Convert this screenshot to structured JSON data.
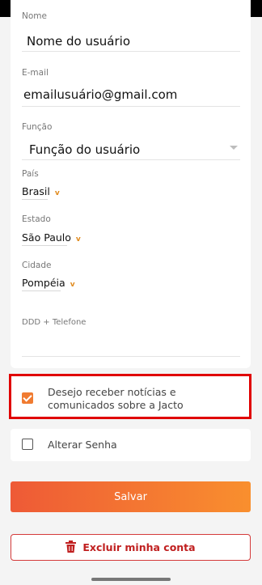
{
  "form": {
    "name_label": "Nome",
    "name_value": "Nome do usuário",
    "email_label": "E-mail",
    "email_value": "emailusuário@gmail.com",
    "function_label": "Função",
    "function_value": "Função do usuário",
    "country_label": "País",
    "country_value": "Brasil",
    "state_label": "Estado",
    "state_value": "São Paulo",
    "city_label": "Cidade",
    "city_value": "Pompéia",
    "phone_label": "DDD + Telefone",
    "phone_value": ""
  },
  "options": {
    "news_label": "Desejo receber notícias e comunicados sobre a Jacto",
    "news_checked": true,
    "change_password_label": "Alterar Senha",
    "change_password_checked": false
  },
  "actions": {
    "save_label": "Salvar",
    "delete_label": "Excluir minha conta"
  },
  "colors": {
    "accent": "#f07b31",
    "danger": "#c01f1f",
    "highlight": "#e00000"
  },
  "icons": {
    "dropdown": "chevron-down-icon",
    "delete": "trash-icon",
    "check": "check-icon"
  }
}
